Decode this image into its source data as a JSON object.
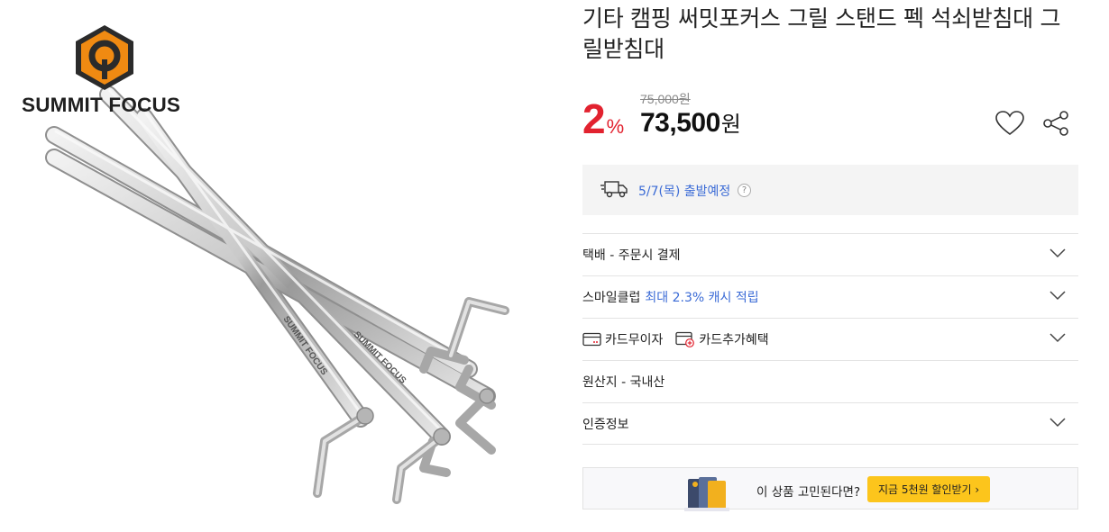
{
  "brand": {
    "name": "SUMMIT FOCUS"
  },
  "peg_engraving": "SUMMIT FOCUS",
  "product": {
    "title": "기타 캠핑 써밋포커스 그릴 스탠드 펙 석쇠받침대 그릴받침대"
  },
  "price": {
    "discount_number": "2",
    "discount_unit": "%",
    "original": "75,000원",
    "sale_value": "73,500",
    "sale_unit": "원"
  },
  "delivery": {
    "date_text": "5/7(목) 출발예정",
    "help_glyph": "?"
  },
  "rows": {
    "shipping": "택배 - 주문시 결제",
    "smile_club_label": "스마일클럽",
    "smile_club_benefit": "최대 2.3% 캐시 적립",
    "card_free_interest": "카드무이자",
    "card_extra_benefit": "카드추가혜택",
    "origin": "원산지 - 국내산",
    "certification": "인증정보"
  },
  "banner": {
    "message": "이 상품 고민된다면?",
    "cta": "지금 5천원 할인받기 ›"
  },
  "icons": {
    "wishlist": "heart-outline-icon",
    "share": "share-icon",
    "delivery": "truck-icon",
    "expand": "chevron-down-icon"
  },
  "colors": {
    "discount": "#e2222f",
    "link_blue": "#3b6bd6",
    "cta_yellow": "#fcc51c",
    "logo_orange": "#f08a12"
  }
}
